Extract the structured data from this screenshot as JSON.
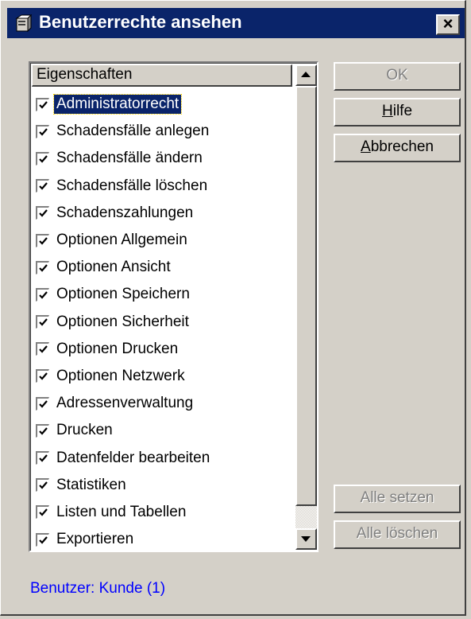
{
  "window": {
    "title": "Benutzerrechte ansehen",
    "close_label": "×",
    "icon": "server-icon"
  },
  "list": {
    "header": "Eigenschaften",
    "items": [
      {
        "label": "Administratorrecht",
        "checked": true,
        "selected": true
      },
      {
        "label": "Schadensfälle anlegen",
        "checked": true
      },
      {
        "label": "Schadensfälle ändern",
        "checked": true
      },
      {
        "label": "Schadensfälle löschen",
        "checked": true
      },
      {
        "label": "Schadenszahlungen",
        "checked": true
      },
      {
        "label": "Optionen Allgemein",
        "checked": true
      },
      {
        "label": "Optionen Ansicht",
        "checked": true
      },
      {
        "label": "Optionen Speichern",
        "checked": true
      },
      {
        "label": "Optionen Sicherheit",
        "checked": true
      },
      {
        "label": "Optionen Drucken",
        "checked": true
      },
      {
        "label": "Optionen Netzwerk",
        "checked": true
      },
      {
        "label": "Adressenverwaltung",
        "checked": true
      },
      {
        "label": "Drucken",
        "checked": true
      },
      {
        "label": "Datenfelder bearbeiten",
        "checked": true
      },
      {
        "label": "Statistiken",
        "checked": true
      },
      {
        "label": "Listen und Tabellen",
        "checked": true
      },
      {
        "label": "Exportieren",
        "checked": true
      }
    ]
  },
  "buttons": {
    "ok": "OK",
    "hilfe": "Hilfe",
    "abbrechen": "Abbrechen",
    "alle_setzen": "Alle setzen",
    "alle_loeschen": "Alle löschen"
  },
  "status": "Benutzer: Kunde (1)",
  "colors": {
    "titlebar": "#0a246a",
    "dialog_bg": "#d4d0c8",
    "status_text": "#0000ff",
    "selection": "#0a246a"
  }
}
